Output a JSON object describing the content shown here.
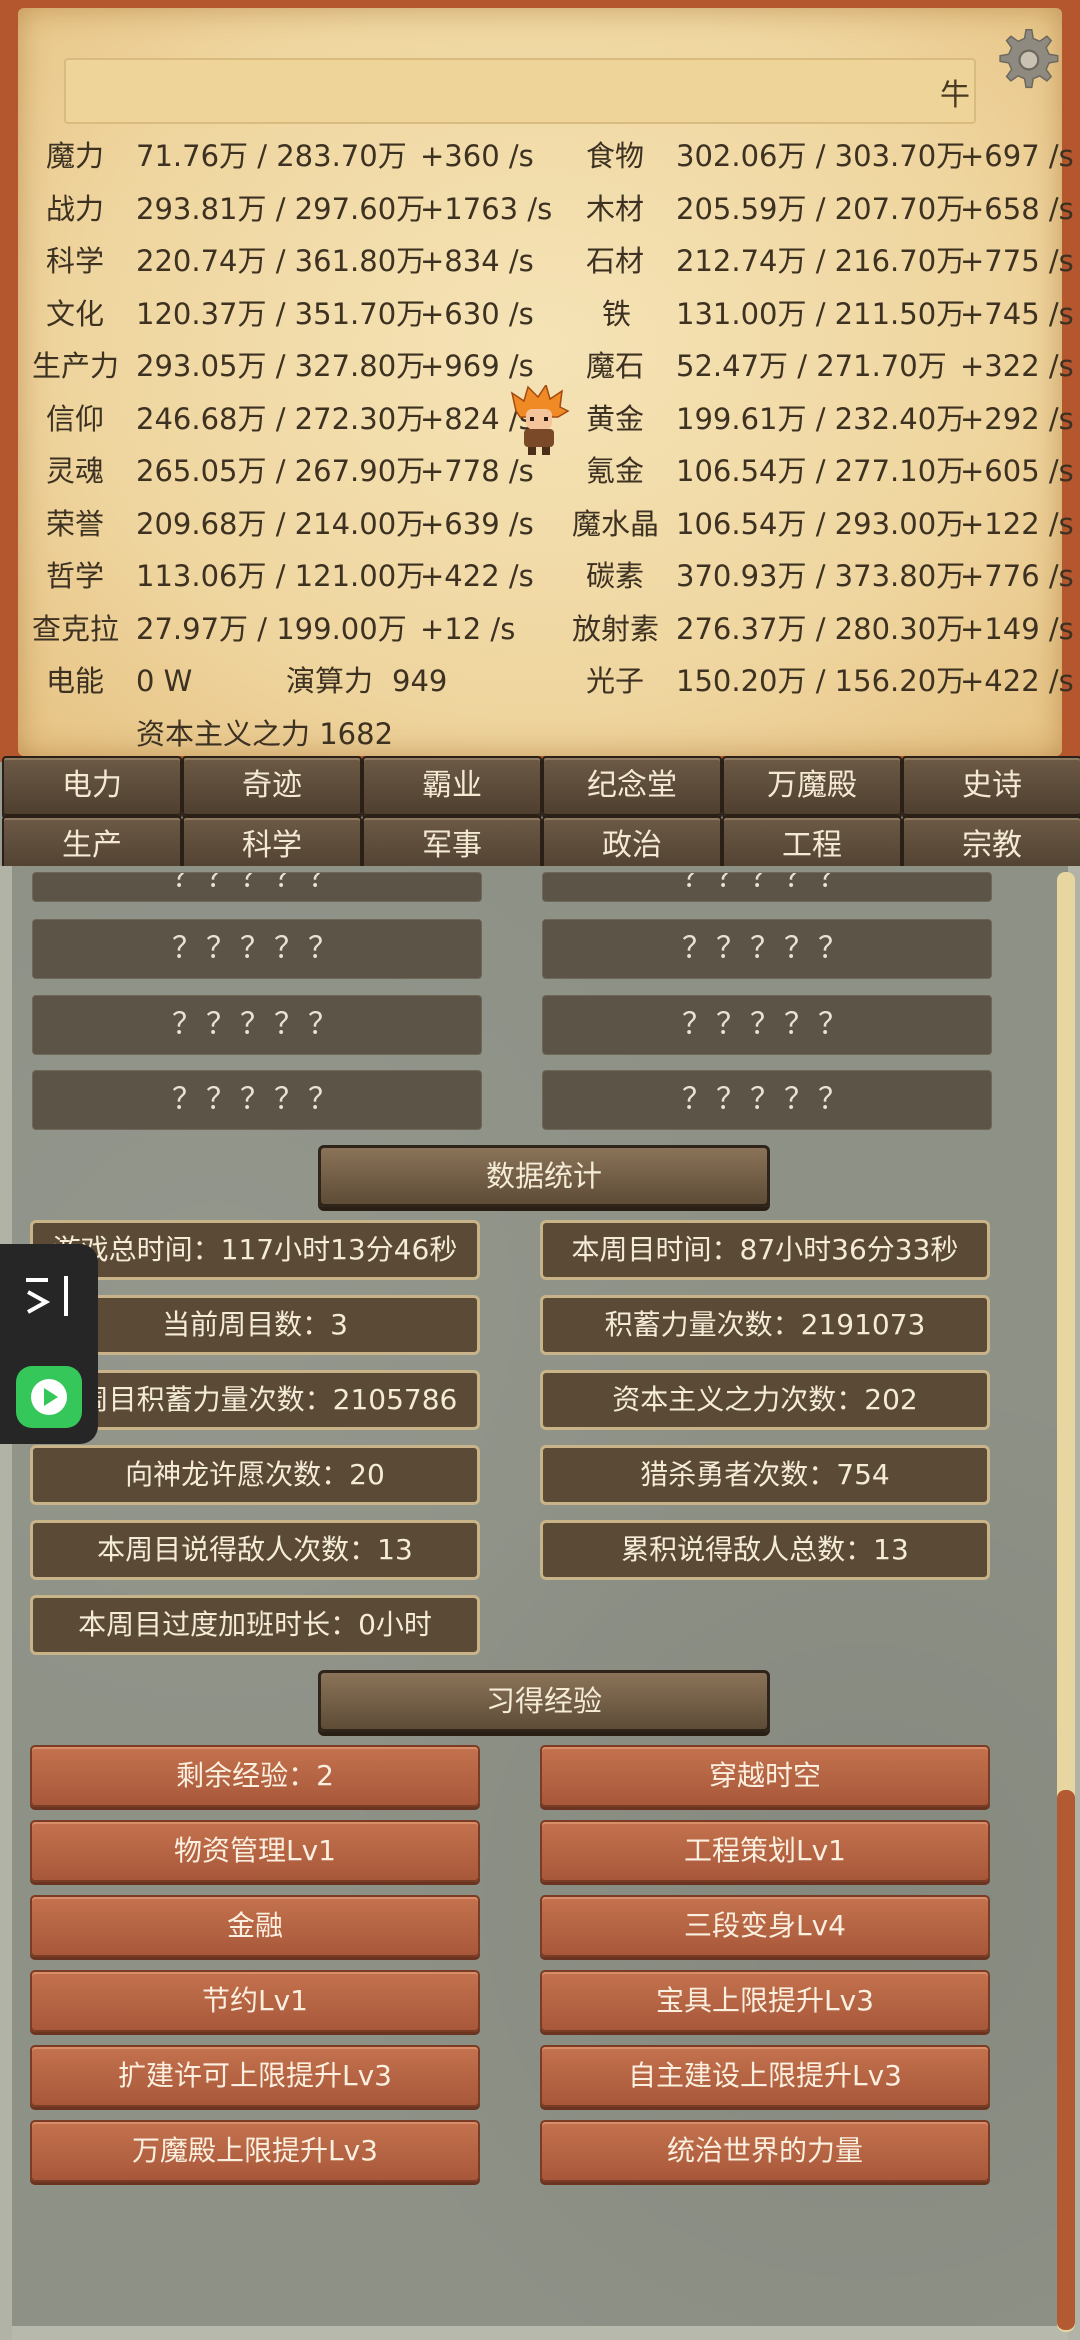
{
  "topbar": {
    "glyph": "牛"
  },
  "resources_left": [
    {
      "name": "魔力",
      "amount": "71.76万 / 283.70万",
      "rate": "+360 /s"
    },
    {
      "name": "战力",
      "amount": "293.81万 / 297.60万",
      "rate": "+1763 /s"
    },
    {
      "name": "科学",
      "amount": "220.74万 / 361.80万",
      "rate": "+834 /s"
    },
    {
      "name": "文化",
      "amount": "120.37万 / 351.70万",
      "rate": "+630 /s"
    },
    {
      "name": "生产力",
      "amount": "293.05万 / 327.80万",
      "rate": "+969 /s"
    },
    {
      "name": "信仰",
      "amount": "246.68万 / 272.30万",
      "rate": "+824 /s"
    },
    {
      "name": "灵魂",
      "amount": "265.05万 / 267.90万",
      "rate": "+778 /s"
    },
    {
      "name": "荣誉",
      "amount": "209.68万 / 214.00万",
      "rate": "+639 /s"
    },
    {
      "name": "哲学",
      "amount": "113.06万 / 121.00万",
      "rate": "+422 /s"
    },
    {
      "name": "查克拉",
      "amount": "27.97万 / 199.00万",
      "rate": "+12 /s"
    }
  ],
  "resources_right": [
    {
      "name": "食物",
      "amount": "302.06万 / 303.70万",
      "rate": "+697 /s"
    },
    {
      "name": "木材",
      "amount": "205.59万 / 207.70万",
      "rate": "+658 /s"
    },
    {
      "name": "石材",
      "amount": "212.74万 / 216.70万",
      "rate": "+775 /s"
    },
    {
      "name": "铁",
      "amount": "131.00万 / 211.50万",
      "rate": "+745 /s"
    },
    {
      "name": "魔石",
      "amount": "52.47万 / 271.70万",
      "rate": "+322 /s"
    },
    {
      "name": "黄金",
      "amount": "199.61万 / 232.40万",
      "rate": "+292 /s"
    },
    {
      "name": "氪金",
      "amount": "106.54万 / 277.10万",
      "rate": "+605 /s"
    },
    {
      "name": "魔水晶",
      "amount": "106.54万 / 293.00万",
      "rate": "+122 /s"
    },
    {
      "name": "碳素",
      "amount": "370.93万 / 373.80万",
      "rate": "+776 /s"
    },
    {
      "name": "放射素",
      "amount": "276.37万 / 280.30万",
      "rate": "+149 /s"
    },
    {
      "name": "光子",
      "amount": "150.20万 / 156.20万",
      "rate": "+422 /s"
    }
  ],
  "power": {
    "name": "电能",
    "value": "0 W"
  },
  "compute": {
    "name": "演算力",
    "value": "949"
  },
  "capitalism": "资本主义之力 1682",
  "tabs_row1": [
    "电力",
    "奇迹",
    "霸业",
    "纪念堂",
    "万魔殿",
    "史诗"
  ],
  "tabs_row2": [
    "生产",
    "科学",
    "军事",
    "政治",
    "工程",
    "宗教"
  ],
  "locked_slot": "？？？？？",
  "stats_header": "数据统计",
  "stats": [
    "游戏总时间：117小时13分46秒",
    "本周目时间：87小时36分33秒",
    "当前周目数：3",
    "积蓄力量次数：2191073",
    "本周目积蓄力量次数：2105786",
    "资本主义之力次数：202",
    "向神龙许愿次数：20",
    "猎杀勇者次数：754",
    "本周目说得敌人次数：13",
    "累积说得敌人总数：13",
    "本周目过度加班时长：0小时"
  ],
  "exp_header": "习得经验",
  "skills": [
    "剩余经验：2",
    "穿越时空",
    "物资管理Lv1",
    "工程策划Lv1",
    "金融",
    "三段变身Lv4",
    "节约Lv1",
    "宝具上限提升Lv3",
    "扩建许可上限提升Lv3",
    "自主建设上限提升Lv3",
    "万魔殿上限提升Lv3",
    "统治世界的力量"
  ],
  "colors": {
    "accent_skill": "#b5623f",
    "tab_bg": "#5c4a38",
    "parchment": "#f0d9a6",
    "frame": "#b5572e"
  }
}
